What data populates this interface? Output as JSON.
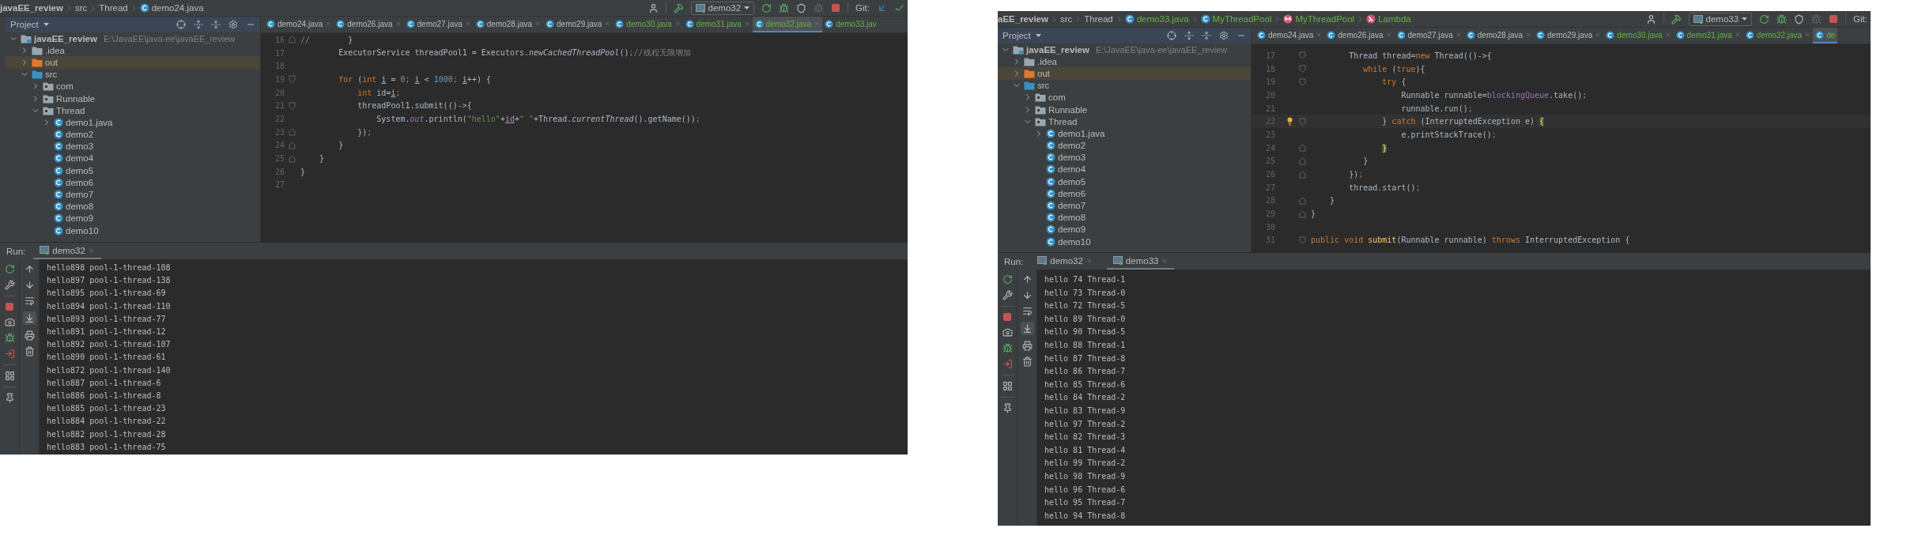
{
  "panels": [
    {
      "breadcrumbs": [
        {
          "label": "javaEE_review",
          "kind": "project",
          "added": false
        },
        {
          "label": "src",
          "kind": "dir",
          "added": false
        },
        {
          "label": "Thread",
          "kind": "dir",
          "added": false
        },
        {
          "label": "demo24.java",
          "kind": "class",
          "added": false
        }
      ],
      "toolbar": {
        "run_config": "demo32",
        "git_label": "Git:",
        "git_actions": true
      },
      "project": {
        "title": "Project",
        "tree": [
          {
            "label": "javaEE_review",
            "path": "E:\\JavaEE\\java-ee\\javaEE_review",
            "kind": "module",
            "expanded": true,
            "selected": false,
            "children": [
              {
                "label": ".idea",
                "kind": "folder",
                "expanded": false,
                "selected": false
              },
              {
                "label": "out",
                "kind": "excluded",
                "expanded": false,
                "selected": true
              },
              {
                "label": "src",
                "kind": "source",
                "expanded": true,
                "selected": false,
                "children": [
                  {
                    "label": "com",
                    "kind": "package",
                    "expanded": false,
                    "selected": false
                  },
                  {
                    "label": "Runnable",
                    "kind": "package",
                    "expanded": false,
                    "selected": false
                  },
                  {
                    "label": "Thread",
                    "kind": "package",
                    "expanded": true,
                    "selected": false,
                    "children": [
                      {
                        "label": "demo1.java",
                        "kind": "class",
                        "expanded": false,
                        "selected": false
                      },
                      {
                        "label": "demo2",
                        "kind": "class",
                        "selected": false
                      },
                      {
                        "label": "demo3",
                        "kind": "class",
                        "selected": false
                      },
                      {
                        "label": "demo4",
                        "kind": "class",
                        "selected": false
                      },
                      {
                        "label": "demo5",
                        "kind": "class",
                        "selected": false
                      },
                      {
                        "label": "demo6",
                        "kind": "class",
                        "selected": false
                      },
                      {
                        "label": "demo7",
                        "kind": "class",
                        "selected": false
                      },
                      {
                        "label": "demo8",
                        "kind": "class",
                        "selected": false
                      },
                      {
                        "label": "demo9",
                        "kind": "class",
                        "selected": false
                      },
                      {
                        "label": "demo10",
                        "kind": "class",
                        "selected": false
                      }
                    ]
                  }
                ]
              }
            ]
          }
        ]
      },
      "tabs": [
        {
          "label": "demo24.java",
          "selected": false,
          "added": false
        },
        {
          "label": "demo26.java",
          "selected": false,
          "added": false
        },
        {
          "label": "demo27.java",
          "selected": false,
          "added": false
        },
        {
          "label": "demo28.java",
          "selected": false,
          "added": false
        },
        {
          "label": "demo29.java",
          "selected": false,
          "added": false
        },
        {
          "label": "demo30.java",
          "selected": false,
          "added": true
        },
        {
          "label": "demo31.java",
          "selected": false,
          "added": true
        },
        {
          "label": "demo32.java",
          "selected": true,
          "added": true
        },
        {
          "label": "demo33.jav",
          "selected": false,
          "added": true
        }
      ],
      "editor": {
        "lines": [
          {
            "number": "16",
            "fold_start": false,
            "fold_end": true,
            "tokens": [
              {
                "text": "//",
                "kind": "comment"
              },
              {
                "text": "        }",
                "kind": "plain"
              }
            ]
          },
          {
            "number": "17",
            "fold_start": false,
            "fold_end": false,
            "tokens": [
              {
                "text": "        ExecutorService threadPool1 = Executors.",
                "kind": "plain"
              },
              {
                "text": "newCachedThreadPool",
                "kind": "italic"
              },
              {
                "text": "()",
                "kind": "plain"
              },
              {
                "text": ";",
                "kind": "keyword"
              },
              {
                "text": "//线程无限增加",
                "kind": "comment"
              }
            ]
          },
          {
            "number": "18",
            "fold_start": false,
            "fold_end": false
          },
          {
            "number": "19",
            "fold_start": true,
            "fold_end": false,
            "tokens": [
              {
                "text": "        for",
                "kind": "keyword"
              },
              {
                "text": " (",
                "kind": "plain"
              },
              {
                "text": "int ",
                "kind": "keyword"
              },
              {
                "text": "i",
                "kind": "reassigned"
              },
              {
                "text": " = ",
                "kind": "plain"
              },
              {
                "text": "0",
                "kind": "number"
              },
              {
                "text": "; ",
                "kind": "keyword"
              },
              {
                "text": "i",
                "kind": "reassigned"
              },
              {
                "text": " < ",
                "kind": "plain"
              },
              {
                "text": "1000",
                "kind": "number"
              },
              {
                "text": "; ",
                "kind": "keyword"
              },
              {
                "text": "i",
                "kind": "reassigned"
              },
              {
                "text": "++) {",
                "kind": "plain"
              }
            ]
          },
          {
            "number": "20",
            "fold_start": false,
            "fold_end": false,
            "tokens": [
              {
                "text": "            int",
                "kind": "keyword"
              },
              {
                "text": " id=",
                "kind": "plain"
              },
              {
                "text": "i",
                "kind": "reassigned"
              },
              {
                "text": ";",
                "kind": "keyword"
              }
            ]
          },
          {
            "number": "21",
            "fold_start": true,
            "fold_end": false,
            "tokens": [
              {
                "text": "            threadPool1.submit(()->{",
                "kind": "plain"
              }
            ]
          },
          {
            "number": "22",
            "fold_start": false,
            "fold_end": false,
            "tokens": [
              {
                "text": "                System.",
                "kind": "plain"
              },
              {
                "text": "out",
                "kind": "static"
              },
              {
                "text": ".println(",
                "kind": "plain"
              },
              {
                "text": "\"hello\"",
                "kind": "string"
              },
              {
                "text": "+",
                "kind": "plain"
              },
              {
                "text": "id",
                "kind": "captured"
              },
              {
                "text": "+",
                "kind": "plain"
              },
              {
                "text": "\" \"",
                "kind": "string"
              },
              {
                "text": "+Thread.",
                "kind": "plain"
              },
              {
                "text": "currentThread",
                "kind": "italic"
              },
              {
                "text": "().getName())",
                "kind": "plain"
              },
              {
                "text": ";",
                "kind": "keyword"
              }
            ]
          },
          {
            "number": "23",
            "fold_start": false,
            "fold_end": true,
            "tokens": [
              {
                "text": "            })",
                "kind": "plain"
              },
              {
                "text": ";",
                "kind": "keyword"
              }
            ]
          },
          {
            "number": "24",
            "fold_start": false,
            "fold_end": true,
            "tokens": [
              {
                "text": "        }",
                "kind": "plain"
              }
            ]
          },
          {
            "number": "25",
            "fold_start": false,
            "fold_end": true,
            "tokens": [
              {
                "text": "    }",
                "kind": "plain"
              }
            ]
          },
          {
            "number": "26",
            "fold_start": false,
            "fold_end": false,
            "tokens": [
              {
                "text": "}",
                "kind": "plain"
              }
            ]
          },
          {
            "number": "27",
            "fold_start": false,
            "fold_end": false
          }
        ]
      },
      "run": {
        "label": "Run:",
        "tabs": [
          {
            "label": "demo32",
            "selected": true
          }
        ],
        "console": [
          "hello898 pool-1-thread-108",
          "hello897 pool-1-thread-138",
          "hello895 pool-1-thread-69",
          "hello894 pool-1-thread-110",
          "hello893 pool-1-thread-77",
          "hello891 pool-1-thread-12",
          "hello892 pool-1-thread-107",
          "hello890 pool-1-thread-61",
          "hello872 pool-1-thread-140",
          "hello887 pool-1-thread-6",
          "hello886 pool-1-thread-8",
          "hello885 pool-1-thread-23",
          "hello884 pool-1-thread-22",
          "hello882 pool-1-thread-28",
          "hello883 pool-1-thread-75"
        ]
      }
    },
    {
      "breadcrumbs": [
        {
          "label": "aEE_review",
          "kind": "project",
          "added": false
        },
        {
          "label": "src",
          "kind": "dir",
          "added": false
        },
        {
          "label": "Thread",
          "kind": "dir",
          "added": false
        },
        {
          "label": "demo33.java",
          "kind": "class",
          "added": true
        },
        {
          "label": "MyThreadPool",
          "kind": "class",
          "added": true
        },
        {
          "label": "MyThreadPool",
          "kind": "method",
          "added": true
        },
        {
          "label": "Lambda",
          "kind": "lambda",
          "added": true
        }
      ],
      "toolbar": {
        "run_config": "demo33",
        "git_label": "Git:",
        "git_actions": false
      },
      "project": {
        "title": "Project",
        "tree": [
          {
            "label": "javaEE_review",
            "path": "E:\\JavaEE\\java-ee\\javaEE_review",
            "kind": "module",
            "expanded": true,
            "selected": false,
            "children": [
              {
                "label": ".idea",
                "kind": "folder",
                "expanded": false,
                "selected": false
              },
              {
                "label": "out",
                "kind": "excluded",
                "expanded": false,
                "selected": true
              },
              {
                "label": "src",
                "kind": "source",
                "expanded": true,
                "selected": false,
                "children": [
                  {
                    "label": "com",
                    "kind": "package",
                    "expanded": false,
                    "selected": false
                  },
                  {
                    "label": "Runnable",
                    "kind": "package",
                    "expanded": false,
                    "selected": false
                  },
                  {
                    "label": "Thread",
                    "kind": "package",
                    "expanded": true,
                    "selected": false,
                    "children": [
                      {
                        "label": "demo1.java",
                        "kind": "class",
                        "expanded": false,
                        "selected": false
                      },
                      {
                        "label": "demo2",
                        "kind": "class",
                        "selected": false
                      },
                      {
                        "label": "demo3",
                        "kind": "class",
                        "selected": false
                      },
                      {
                        "label": "demo4",
                        "kind": "class",
                        "selected": false
                      },
                      {
                        "label": "demo5",
                        "kind": "class",
                        "selected": false
                      },
                      {
                        "label": "demo6",
                        "kind": "class",
                        "selected": false
                      },
                      {
                        "label": "demo7",
                        "kind": "class",
                        "selected": false
                      },
                      {
                        "label": "demo8",
                        "kind": "class",
                        "selected": false
                      },
                      {
                        "label": "demo9",
                        "kind": "class",
                        "selected": false
                      },
                      {
                        "label": "demo10",
                        "kind": "class",
                        "selected": false
                      }
                    ]
                  }
                ]
              }
            ]
          }
        ]
      },
      "tabs": [
        {
          "label": "demo24.java",
          "selected": false,
          "added": false
        },
        {
          "label": "demo26.java",
          "selected": false,
          "added": false
        },
        {
          "label": "demo27.java",
          "selected": false,
          "added": false
        },
        {
          "label": "demo28.java",
          "selected": false,
          "added": false
        },
        {
          "label": "demo29.java",
          "selected": false,
          "added": false
        },
        {
          "label": "demo30.java",
          "selected": false,
          "added": true
        },
        {
          "label": "demo31.java",
          "selected": false,
          "added": true
        },
        {
          "label": "demo32.java",
          "selected": false,
          "added": true
        },
        {
          "label": "de",
          "selected": true,
          "added": true
        }
      ],
      "editor": {
        "lines": [
          {
            "number": "17",
            "fold_start": true,
            "fold_end": false,
            "tokens": [
              {
                "text": "        Thread thread=",
                "kind": "plain"
              },
              {
                "text": "new",
                "kind": "keyword"
              },
              {
                "text": " Thread(()->{",
                "kind": "plain"
              }
            ]
          },
          {
            "number": "18",
            "fold_start": true,
            "fold_end": false,
            "tokens": [
              {
                "text": "           while",
                "kind": "keyword"
              },
              {
                "text": " (",
                "kind": "plain"
              },
              {
                "text": "true",
                "kind": "keyword"
              },
              {
                "text": "){",
                "kind": "plain"
              }
            ]
          },
          {
            "number": "19",
            "fold_start": true,
            "fold_end": false,
            "tokens": [
              {
                "text": "               try",
                "kind": "keyword"
              },
              {
                "text": " {",
                "kind": "plain"
              }
            ]
          },
          {
            "number": "20",
            "fold_start": false,
            "fold_end": false,
            "tokens": [
              {
                "text": "                   Runnable runnable=",
                "kind": "plain"
              },
              {
                "text": "blockingQueue",
                "kind": "field"
              },
              {
                "text": ".take()",
                "kind": "plain"
              },
              {
                "text": ";",
                "kind": "keyword"
              }
            ]
          },
          {
            "number": "21",
            "fold_start": false,
            "fold_end": false,
            "tokens": [
              {
                "text": "                   runnable.run()",
                "kind": "plain"
              },
              {
                "text": ";",
                "kind": "keyword"
              }
            ]
          },
          {
            "number": "22",
            "fold_start": true,
            "fold_end": false,
            "current": true,
            "bulb": true,
            "tokens": [
              {
                "text": "               } ",
                "kind": "plain"
              },
              {
                "text": "catch",
                "kind": "keyword"
              },
              {
                "text": " (InterruptedException e) ",
                "kind": "plain"
              },
              {
                "text": "{",
                "kind": "brace"
              }
            ]
          },
          {
            "number": "23",
            "fold_start": false,
            "fold_end": false,
            "tokens": [
              {
                "text": "                   e.printStackTrace()",
                "kind": "plain"
              },
              {
                "text": ";",
                "kind": "keyword"
              }
            ]
          },
          {
            "number": "24",
            "fold_start": false,
            "fold_end": true,
            "tokens": [
              {
                "text": "               }",
                "kind": "brace"
              }
            ]
          },
          {
            "number": "25",
            "fold_start": false,
            "fold_end": true,
            "tokens": [
              {
                "text": "           }",
                "kind": "plain"
              }
            ]
          },
          {
            "number": "26",
            "fold_start": false,
            "fold_end": true,
            "tokens": [
              {
                "text": "        })",
                "kind": "plain"
              },
              {
                "text": ";",
                "kind": "keyword"
              }
            ]
          },
          {
            "number": "27",
            "fold_start": false,
            "fold_end": false,
            "tokens": [
              {
                "text": "        thread.start()",
                "kind": "plain"
              },
              {
                "text": ";",
                "kind": "keyword"
              }
            ]
          },
          {
            "number": "28",
            "fold_start": false,
            "fold_end": true,
            "tokens": [
              {
                "text": "    }",
                "kind": "plain"
              }
            ]
          },
          {
            "number": "29",
            "fold_start": false,
            "fold_end": true,
            "tokens": [
              {
                "text": "}",
                "kind": "plain"
              }
            ]
          },
          {
            "number": "30",
            "fold_start": false,
            "fold_end": false
          },
          {
            "number": "31",
            "fold_start": true,
            "fold_end": false,
            "tokens": [
              {
                "text": "public ",
                "kind": "keyword"
              },
              {
                "text": "void ",
                "kind": "keyword"
              },
              {
                "text": "submit",
                "kind": "decl"
              },
              {
                "text": "(Runnable runnable) ",
                "kind": "plain"
              },
              {
                "text": "throws",
                "kind": "keyword"
              },
              {
                "text": " InterruptedException {",
                "kind": "plain"
              }
            ]
          }
        ]
      },
      "run": {
        "label": "Run:",
        "tabs": [
          {
            "label": "demo32",
            "selected": false
          },
          {
            "label": "demo33",
            "selected": true
          }
        ],
        "console": [
          "hello 74 Thread-1",
          "hello 73 Thread-0",
          "hello 72 Thread-5",
          "hello 89 Thread-0",
          "hello 90 Thread-5",
          "hello 88 Thread-1",
          "hello 87 Thread-8",
          "hello 86 Thread-7",
          "hello 85 Thread-6",
          "hello 84 Thread-2",
          "hello 83 Thread-9",
          "hello 97 Thread-2",
          "hello 82 Thread-3",
          "hello 81 Thread-4",
          "hello 99 Thread-2",
          "hello 98 Thread-9",
          "hello 96 Thread-6",
          "hello 95 Thread-7",
          "hello 94 Thread-8"
        ]
      }
    }
  ]
}
